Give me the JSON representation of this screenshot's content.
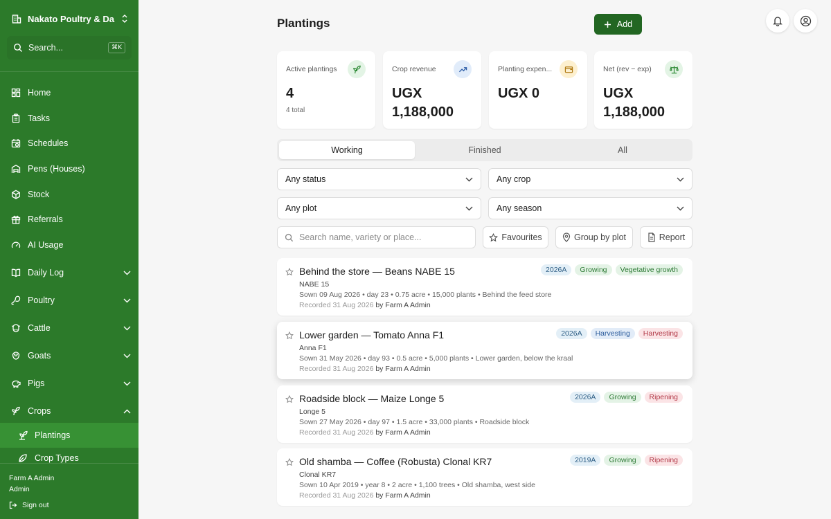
{
  "sidebar": {
    "farm_name": "Nakato Poultry & Da...",
    "search_placeholder": "Search...",
    "search_shortcut": "⌘K",
    "items": [
      {
        "label": "Home",
        "icon": "dashboard-icon"
      },
      {
        "label": "Tasks",
        "icon": "clipboard-icon"
      },
      {
        "label": "Schedules",
        "icon": "calendar-clock-icon"
      },
      {
        "label": "Pens (Houses)",
        "icon": "warehouse-icon"
      },
      {
        "label": "Stock",
        "icon": "box-icon"
      },
      {
        "label": "Referrals",
        "icon": "gift-icon"
      },
      {
        "label": "AI Usage",
        "icon": "gauge-icon"
      },
      {
        "label": "Daily Log",
        "icon": "book-icon"
      },
      {
        "label": "Poultry",
        "icon": "drumstick-icon"
      },
      {
        "label": "Cattle",
        "icon": "cattle-icon"
      },
      {
        "label": "Goats",
        "icon": "goat-icon"
      },
      {
        "label": "Pigs",
        "icon": "pig-icon"
      },
      {
        "label": "Crops",
        "icon": "leaf-icon"
      },
      {
        "label": "Plantings",
        "icon": "sprout-icon"
      },
      {
        "label": "Crop Types",
        "icon": "leaf-icon"
      }
    ],
    "footer": {
      "user_name": "Farm A Admin",
      "role": "Admin",
      "sign_out": "Sign out"
    }
  },
  "header": {
    "title": "Plantings",
    "add_label": "Add"
  },
  "stats": [
    {
      "label": "Active plantings",
      "value": "4",
      "sub": "4 total",
      "color": "#e3f4e5",
      "icon": "sprout-icon"
    },
    {
      "label": "Crop revenue",
      "value": "UGX 1,188,000",
      "sub": "",
      "color": "#e1ecfa",
      "icon": "trending-up-icon"
    },
    {
      "label": "Planting expen...",
      "value": "UGX 0",
      "sub": "",
      "color": "#fdf0cf",
      "icon": "wallet-icon"
    },
    {
      "label": "Net (rev − exp)",
      "value": "UGX 1,188,000",
      "sub": "",
      "color": "#e3f4e5",
      "icon": "scale-icon"
    }
  ],
  "tabs": [
    {
      "label": "Working",
      "active": true
    },
    {
      "label": "Finished",
      "active": false
    },
    {
      "label": "All",
      "active": false
    }
  ],
  "filters": {
    "status": "Any status",
    "crop": "Any crop",
    "plot": "Any plot",
    "season": "Any season"
  },
  "toolbar": {
    "search_placeholder": "Search name, variety or place...",
    "favourites": "Favourites",
    "group_by_plot": "Group by plot",
    "report": "Report"
  },
  "plantings": [
    {
      "title": "Behind the store — Beans NABE 15",
      "variety": "NABE 15",
      "meta": "Sown 09 Aug 2026 • day 23 • 0.75 acre • 15,000 plants • Behind the feed store",
      "recorded": "Recorded 31 Aug 2026",
      "by": "by Farm A Admin",
      "tags": [
        "2026A",
        "Growing",
        "Vegetative growth"
      ]
    },
    {
      "title": "Lower garden — Tomato Anna F1",
      "variety": "Anna F1",
      "meta": "Sown 31 May 2026 • day 93 • 0.5 acre • 5,000 plants • Lower garden, below the kraal",
      "recorded": "Recorded 31 Aug 2026",
      "by": "by Farm A Admin",
      "tags": [
        "2026A",
        "Harvesting",
        "Harvesting"
      ]
    },
    {
      "title": "Roadside block — Maize Longe 5",
      "variety": "Longe 5",
      "meta": "Sown 27 May 2026 • day 97 • 1.5 acre • 33,000 plants • Roadside block",
      "recorded": "Recorded 31 Aug 2026",
      "by": "by Farm A Admin",
      "tags": [
        "2026A",
        "Growing",
        "Ripening"
      ]
    },
    {
      "title": "Old shamba — Coffee (Robusta) Clonal KR7",
      "variety": "Clonal KR7",
      "meta": "Sown 10 Apr 2019 • year 8 • 2 acre • 1,100 trees • Old shamba, west side",
      "recorded": "Recorded 31 Aug 2026",
      "by": "by Farm A Admin",
      "tags": [
        "2019A",
        "Growing",
        "Ripening"
      ]
    }
  ]
}
